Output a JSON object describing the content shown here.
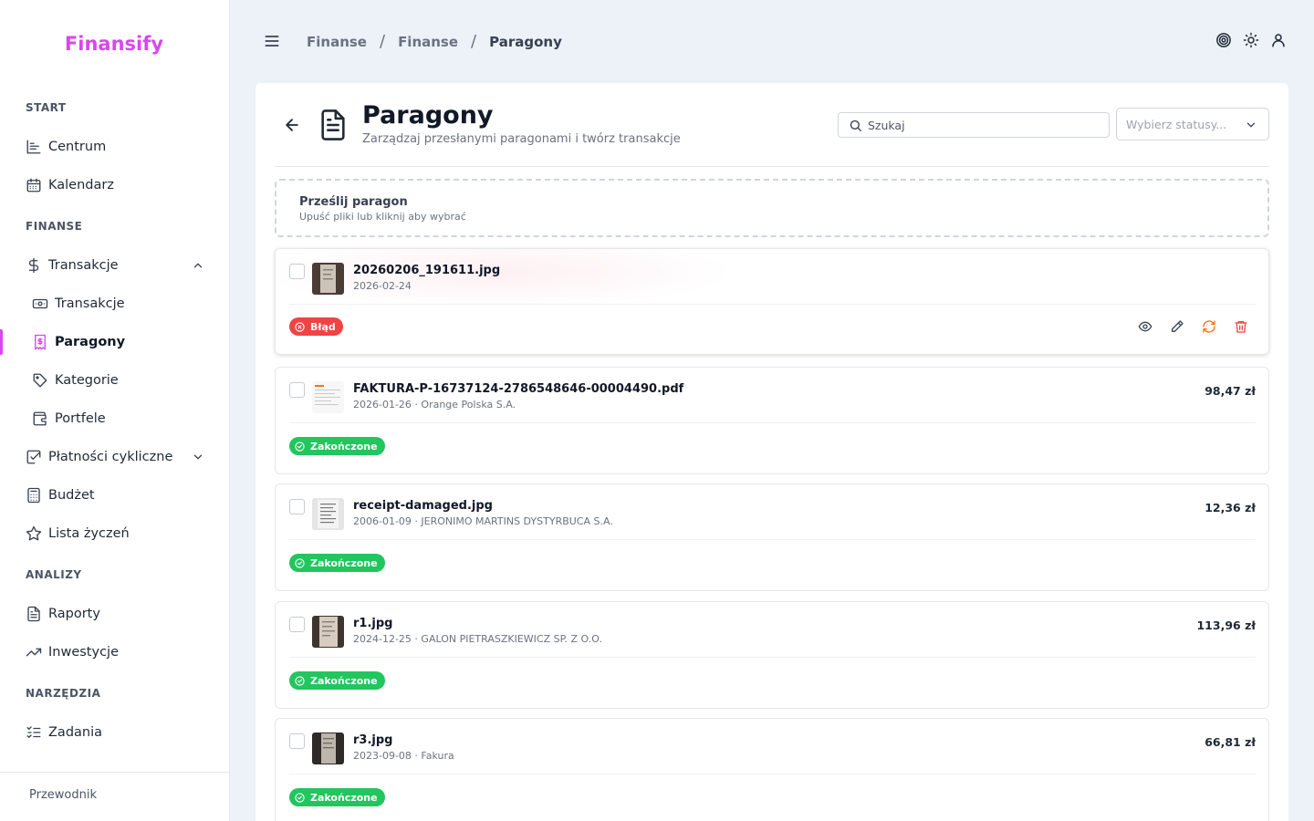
{
  "app": {
    "name": "Finansify"
  },
  "sidebar": {
    "sections": [
      {
        "label": "START"
      },
      {
        "label": "FINANSE"
      },
      {
        "label": "ANALIZY"
      },
      {
        "label": "NARZĘDZIA"
      }
    ],
    "items": [
      {
        "label": "Centrum",
        "icon": "chart-icon"
      },
      {
        "label": "Kalendarz",
        "icon": "calendar-icon"
      },
      {
        "label": "Transakcje",
        "icon": "dollar-icon"
      },
      {
        "label": "Transakcje",
        "icon": "banknote-icon"
      },
      {
        "label": "Paragony",
        "icon": "receipt-icon"
      },
      {
        "label": "Kategorie",
        "icon": "tag-icon"
      },
      {
        "label": "Portfele",
        "icon": "wallet-icon"
      },
      {
        "label": "Płatności cykliczne",
        "icon": "calendar-check-icon"
      },
      {
        "label": "Budżet",
        "icon": "calculator-icon"
      },
      {
        "label": "Lista życzeń",
        "icon": "star-icon"
      },
      {
        "label": "Raporty",
        "icon": "file-text-icon"
      },
      {
        "label": "Inwestycje",
        "icon": "trending-up-icon"
      },
      {
        "label": "Zadania",
        "icon": "list-checks-icon"
      }
    ],
    "footer": "Przewodnik"
  },
  "breadcrumb": [
    "Finanse",
    "Finanse",
    "Paragony"
  ],
  "page": {
    "title": "Paragony",
    "subtitle": "Zarządzaj przesłanymi paragonami i twórz transakcje"
  },
  "search": {
    "placeholder": "Szukaj"
  },
  "status_select": {
    "placeholder": "Wybierz statusy..."
  },
  "upload": {
    "title": "Prześlij paragon",
    "subtitle": "Upuść pliki lub kliknij aby wybrać"
  },
  "receipts": [
    {
      "name": "20260206_191611.jpg",
      "meta": "2026-02-24",
      "amount": "",
      "status": "Błąd",
      "status_color": "#ef4444"
    },
    {
      "name": "FAKTURA-P-16737124-2786548646-00004490.pdf",
      "meta": "2026-01-26 · Orange Polska S.A.",
      "amount": "98,47 zł",
      "status": "Zakończone",
      "status_color": "#22c55e"
    },
    {
      "name": "receipt-damaged.jpg",
      "meta": "2006-01-09 · JERONIMO MARTINS DYSTYRBUCA S.A.",
      "amount": "12,36 zł",
      "status": "Zakończone",
      "status_color": "#22c55e"
    },
    {
      "name": "r1.jpg",
      "meta": "2024-12-25 · GALON PIETRASZKIEWICZ SP. Z O.O.",
      "amount": "113,96 zł",
      "status": "Zakończone",
      "status_color": "#22c55e"
    },
    {
      "name": "r3.jpg",
      "meta": "2023-09-08 · Fakura",
      "amount": "66,81 zł",
      "status": "Zakończone",
      "status_color": "#22c55e"
    }
  ],
  "colors": {
    "brand": "#d946ef",
    "error": "#ef4444",
    "success": "#22c55e",
    "warning": "#f97316"
  }
}
